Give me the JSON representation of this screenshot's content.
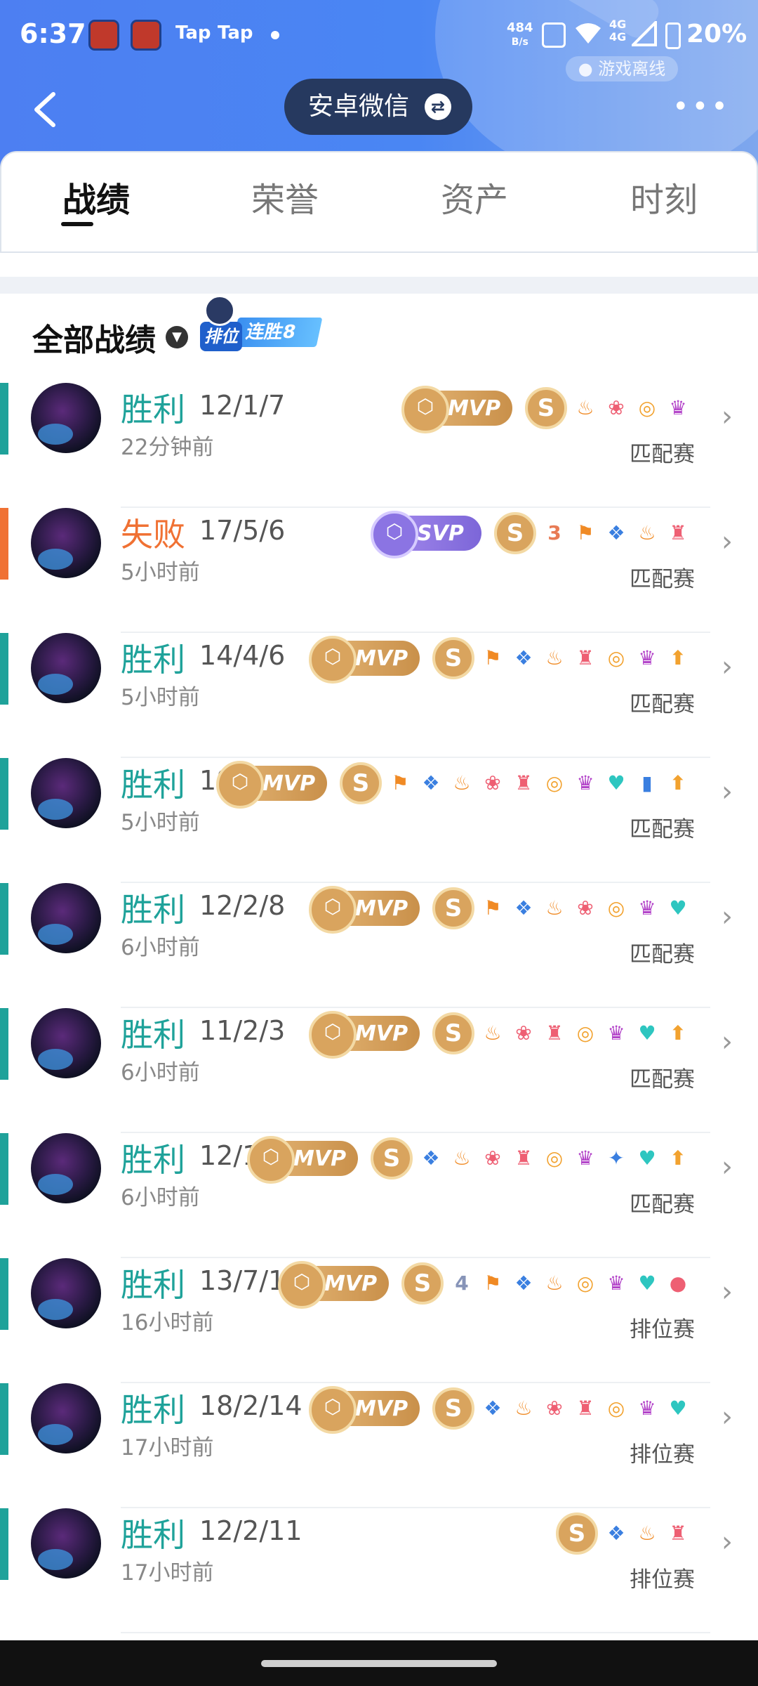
{
  "status_bar": {
    "time": "6:37",
    "tap_1": "Tap",
    "tap_2": "Tap",
    "net_speed_value": "484",
    "net_speed_unit": "B/s",
    "battery": "20%",
    "network": "4G"
  },
  "header": {
    "offline_label": "游戏离线",
    "account_label": "安卓微信",
    "more_label": "•••"
  },
  "tabs": [
    "战绩",
    "荣誉",
    "资产",
    "时刻"
  ],
  "section": {
    "title": "全部战绩",
    "streak_tag": "排位",
    "streak_label": "连胜8"
  },
  "colors": {
    "win": "#1fa29a",
    "loss": "#f07133",
    "accent": "#4a86f3"
  },
  "matches": [
    {
      "result": "胜利",
      "kda": "12/1/7",
      "ago": "22分钟前",
      "mode": "匹配赛",
      "badge": "MVP",
      "icons": [
        "fire",
        "lotus",
        "coins",
        "demon"
      ]
    },
    {
      "result": "失败",
      "kda": "17/5/6",
      "ago": "5小时前",
      "mode": "匹配赛",
      "badge": "SVP",
      "icons": [
        "3",
        "flag",
        "splash",
        "fire",
        "tower"
      ]
    },
    {
      "result": "胜利",
      "kda": "14/4/6",
      "ago": "5小时前",
      "mode": "匹配赛",
      "badge": "MVP",
      "icons": [
        "flag",
        "splash",
        "fire",
        "tower",
        "coins",
        "demon",
        "gold-up"
      ]
    },
    {
      "result": "胜利",
      "kda": "18",
      "ago": "5小时前",
      "mode": "匹配赛",
      "badge": "MVP",
      "icons": [
        "flag",
        "splash",
        "fire",
        "lotus",
        "tower",
        "coins",
        "demon",
        "heart-plus",
        "tank",
        "gold-up"
      ]
    },
    {
      "result": "胜利",
      "kda": "12/2/8",
      "ago": "6小时前",
      "mode": "匹配赛",
      "badge": "MVP",
      "icons": [
        "flag",
        "splash",
        "fire",
        "lotus",
        "coins",
        "demon",
        "heart-plus"
      ]
    },
    {
      "result": "胜利",
      "kda": "11/2/3",
      "ago": "6小时前",
      "mode": "匹配赛",
      "badge": "MVP",
      "icons": [
        "fire",
        "lotus",
        "tower",
        "coins",
        "demon",
        "heart-plus",
        "gold-up"
      ]
    },
    {
      "result": "胜利",
      "kda": "12/1",
      "ago": "6小时前",
      "mode": "匹配赛",
      "badge": "MVP",
      "icons": [
        "splash",
        "fire",
        "lotus",
        "tower",
        "coins",
        "demon",
        "sparrow",
        "heart-plus",
        "gold-up"
      ]
    },
    {
      "result": "胜利",
      "kda": "13/7/1",
      "ago": "16小时前",
      "mode": "排位赛",
      "badge": "MVP",
      "icons": [
        "4",
        "flag",
        "splash",
        "fire",
        "coins",
        "demon",
        "heart-plus",
        "drop"
      ]
    },
    {
      "result": "胜利",
      "kda": "18/2/14",
      "ago": "17小时前",
      "mode": "排位赛",
      "badge": "MVP",
      "icons": [
        "splash",
        "fire",
        "lotus",
        "tower",
        "coins",
        "demon",
        "heart-plus"
      ]
    },
    {
      "result": "胜利",
      "kda": "12/2/11",
      "ago": "17小时前",
      "mode": "排位赛",
      "badge": "",
      "icons": [
        "splash",
        "fire",
        "tower"
      ]
    }
  ]
}
